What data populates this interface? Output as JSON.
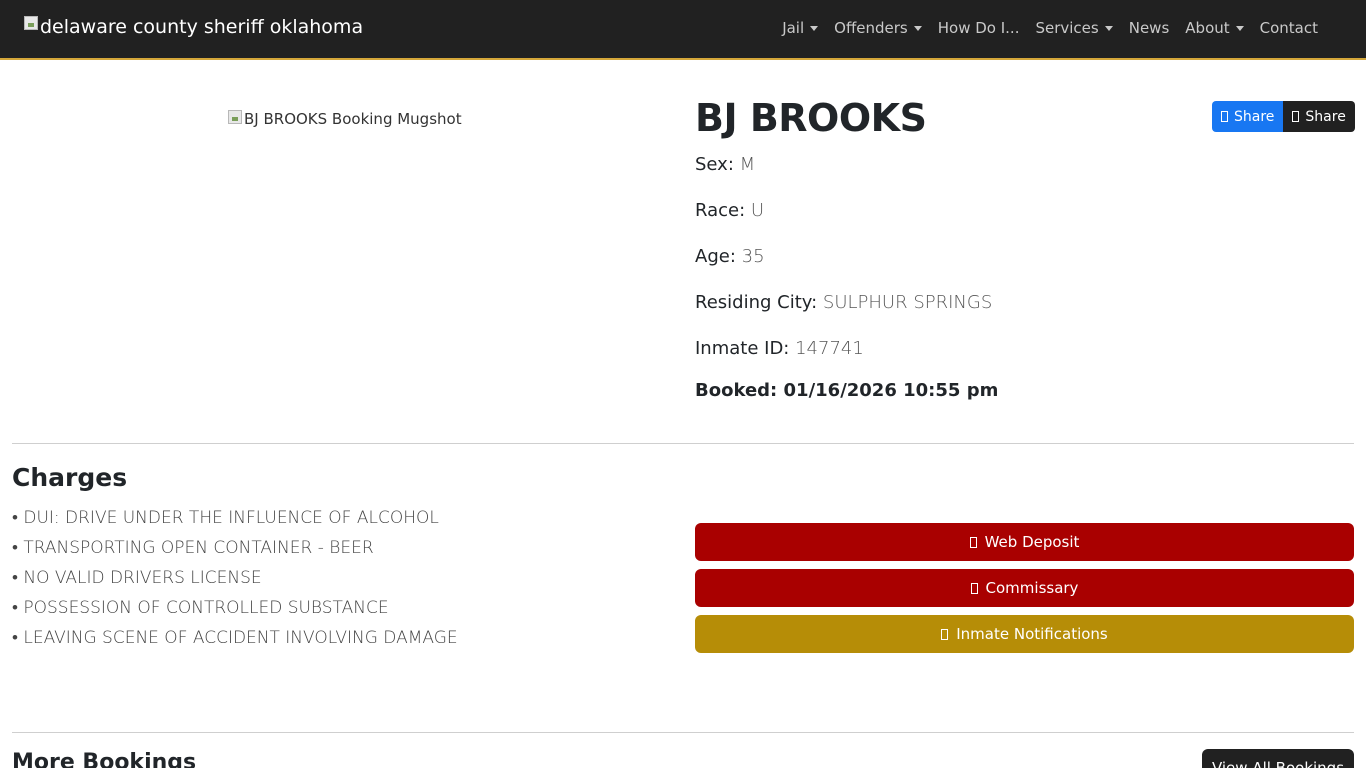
{
  "header": {
    "brand_alt": "delaware county sheriff oklahoma",
    "nav": [
      {
        "label": "Jail",
        "dropdown": true
      },
      {
        "label": "Offenders",
        "dropdown": true
      },
      {
        "label": "How Do I...",
        "dropdown": false
      },
      {
        "label": "Services",
        "dropdown": true
      },
      {
        "label": "News",
        "dropdown": false
      },
      {
        "label": "About",
        "dropdown": true
      },
      {
        "label": "Contact",
        "dropdown": false
      }
    ]
  },
  "inmate": {
    "mugshot_alt": "BJ BROOKS Booking Mugshot",
    "name": "BJ BROOKS",
    "details": [
      {
        "label": "Sex:",
        "value": "M"
      },
      {
        "label": "Race:",
        "value": "U"
      },
      {
        "label": "Age:",
        "value": "35"
      },
      {
        "label": "Residing City:",
        "value": "SULPHUR SPRINGS"
      },
      {
        "label": "Inmate ID:",
        "value": "147741"
      }
    ],
    "booked_label": "Booked:",
    "booked_value": "01/16/2026 10:55 pm"
  },
  "share": {
    "facebook_label": "Share",
    "x_label": "Share"
  },
  "charges": {
    "title": "Charges",
    "items": [
      "• DUI: DRIVE UNDER THE INFLUENCE OF ALCOHOL",
      "• TRANSPORTING OPEN CONTAINER - BEER",
      "• NO VALID DRIVERS LICENSE",
      "• POSSESSION OF CONTROLLED SUBSTANCE",
      "• LEAVING SCENE OF ACCIDENT INVOLVING DAMAGE"
    ]
  },
  "actions": {
    "web_deposit": "Web Deposit",
    "commissary": "Commissary",
    "notifications": "Inmate Notifications"
  },
  "more": {
    "title": "More Bookings",
    "view_all": "View All Bookings"
  },
  "colors": {
    "navbar": "#212121",
    "accent_red": "#a90000",
    "accent_gold": "#b68d07",
    "facebook_blue": "#1877f2"
  }
}
